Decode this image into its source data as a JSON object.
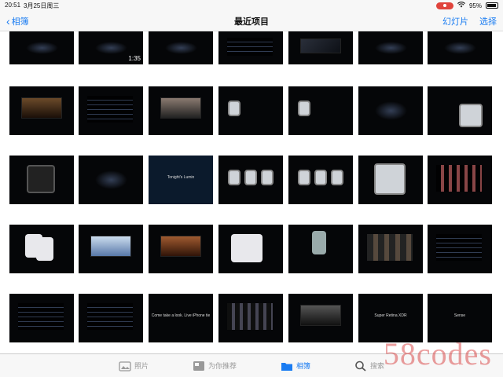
{
  "status_bar": {
    "time": "20:51",
    "date": "3月25日周三",
    "battery_text": "95%",
    "battery_level": 0.95
  },
  "nav": {
    "back_label": "相簿",
    "title": "最近项目",
    "slideshow_label": "幻灯片",
    "select_label": "选择"
  },
  "grid": {
    "duration_label": "1:35",
    "caption_lumin": "Tonight's Lumin",
    "caption_live": "Come take a look. Live iPhone tie",
    "caption_super": "Super Retina XDR",
    "caption_sense": "Sense"
  },
  "tabs": [
    {
      "label": "照片",
      "icon": "photos-icon"
    },
    {
      "label": "为你推荐",
      "icon": "for-you-icon"
    },
    {
      "label": "相簿",
      "icon": "albums-icon"
    },
    {
      "label": "搜索",
      "icon": "search-icon"
    }
  ],
  "watermark": "58codes",
  "colors": {
    "accent": "#1a7cf2",
    "record": "#e0443c"
  }
}
